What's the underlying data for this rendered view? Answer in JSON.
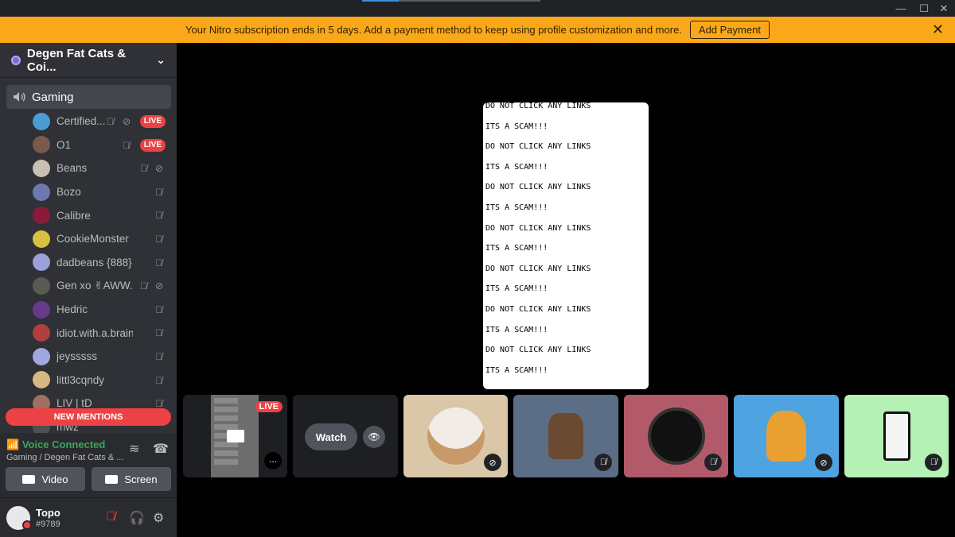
{
  "banner": {
    "message": "Your Nitro subscription ends in 5 days. Add a payment method to keep using profile customization and more.",
    "button": "Add Payment",
    "color": "#faa81a"
  },
  "window": {
    "minimize": "—",
    "maximize": "☐",
    "close": "✕"
  },
  "guild": {
    "name": "Degen Fat Cats & Coi..."
  },
  "channel": {
    "name": "Gaming"
  },
  "users": [
    {
      "name": "Certified...",
      "live": "LIVE",
      "muted": true,
      "deafened": true
    },
    {
      "name": "O1",
      "live": "LIVE",
      "muted": true
    },
    {
      "name": "Beans",
      "muted": true,
      "deafened": true
    },
    {
      "name": "Bozo",
      "muted": true
    },
    {
      "name": "Calibre",
      "muted": true
    },
    {
      "name": "CookieMonster",
      "muted": true
    },
    {
      "name": "dadbeans {888}",
      "muted": true
    },
    {
      "name": "Gen xo ✌AWW...",
      "muted": true,
      "deafened": true
    },
    {
      "name": "Hedric",
      "muted": true
    },
    {
      "name": "idiot.with.a.brain",
      "muted": true
    },
    {
      "name": "jeysssss",
      "muted": true
    },
    {
      "name": "littl3cqndy",
      "muted": true
    },
    {
      "name": "LIV | tD",
      "muted": true
    },
    {
      "name": "mwz",
      "muted": true
    }
  ],
  "new_mentions": "NEW MENTIONS",
  "voice": {
    "status": "Voice Connected",
    "location": "Gaming / Degen Fat Cats & ...",
    "video_label": "Video",
    "screen_label": "Screen"
  },
  "user": {
    "name": "Topo",
    "tag": "#9789"
  },
  "stream": {
    "lines": [
      "DO NOT CLICK ANY LINKS",
      "ITS A SCAM!!!",
      "DO NOT CLICK ANY LINKS",
      "ITS A SCAM!!!",
      "DO NOT CLICK ANY LINKS",
      "ITS A SCAM!!!",
      "DO NOT CLICK ANY LINKS",
      "ITS A SCAM!!!",
      "DO NOT CLICK ANY LINKS",
      "ITS A SCAM!!!",
      "DO NOT CLICK ANY LINKS",
      "ITS A SCAM!!!",
      "DO NOT CLICK ANY LINKS",
      "ITS A SCAM!!!"
    ]
  },
  "tiles": {
    "live_badge": "LIVE",
    "watch_label": "Watch",
    "more": "..."
  },
  "colors": {
    "live": "#ed4245",
    "voice_green": "#3ba55d",
    "sidebar": "#2f3136"
  }
}
